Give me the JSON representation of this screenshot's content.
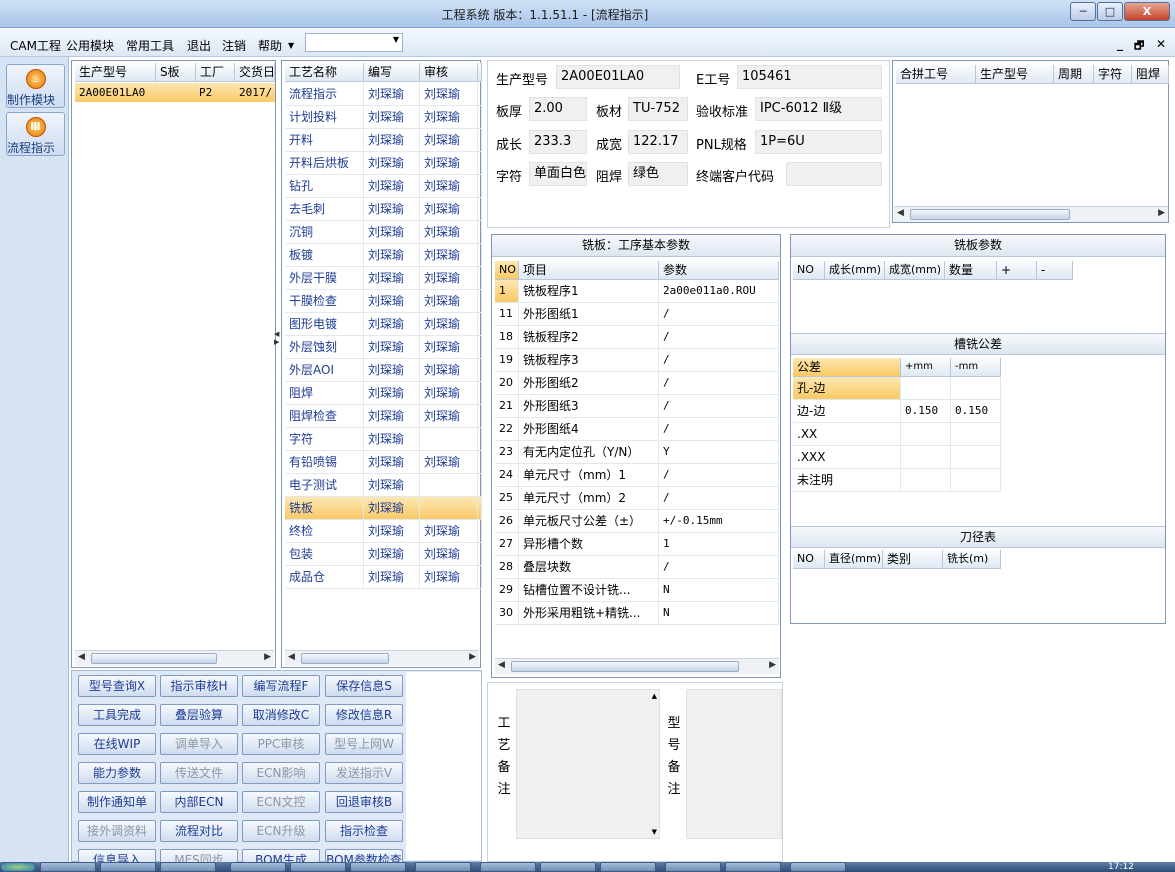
{
  "window": {
    "title": "工程系统   版本：1.1.51.1 - [流程指示]",
    "min_label": "─",
    "max_label": "□",
    "close_label": "X"
  },
  "menu": {
    "items": [
      "CAM工程",
      "公用模块",
      "常用工具",
      "退出",
      "注销",
      "帮助"
    ],
    "combo_value": "",
    "mdi_min": "_",
    "mdi_restore": "🗗",
    "mdi_close": "✕"
  },
  "leftnav": {
    "items": [
      {
        "label": "制作模块"
      },
      {
        "label": "流程指示"
      }
    ]
  },
  "orders": {
    "headers": [
      "生产型号",
      "S板",
      "工厂",
      "交货日"
    ],
    "rows": [
      [
        "2A00E01LA0",
        "",
        "P2",
        "2017/"
      ]
    ]
  },
  "process": {
    "headers": [
      "工艺名称",
      "编写",
      "审核"
    ],
    "rows": [
      [
        "流程指示",
        "刘琛瑜",
        "刘琛瑜"
      ],
      [
        "计划投料",
        "刘琛瑜",
        "刘琛瑜"
      ],
      [
        "开料",
        "刘琛瑜",
        "刘琛瑜"
      ],
      [
        "开料后烘板",
        "刘琛瑜",
        "刘琛瑜"
      ],
      [
        "钻孔",
        "刘琛瑜",
        "刘琛瑜"
      ],
      [
        "去毛刺",
        "刘琛瑜",
        "刘琛瑜"
      ],
      [
        "沉铜",
        "刘琛瑜",
        "刘琛瑜"
      ],
      [
        "板镀",
        "刘琛瑜",
        "刘琛瑜"
      ],
      [
        "外层干膜",
        "刘琛瑜",
        "刘琛瑜"
      ],
      [
        "干膜检查",
        "刘琛瑜",
        "刘琛瑜"
      ],
      [
        "图形电镀",
        "刘琛瑜",
        "刘琛瑜"
      ],
      [
        "外层蚀刻",
        "刘琛瑜",
        "刘琛瑜"
      ],
      [
        "外层AOI",
        "刘琛瑜",
        "刘琛瑜"
      ],
      [
        "阻焊",
        "刘琛瑜",
        "刘琛瑜"
      ],
      [
        "阻焊检查",
        "刘琛瑜",
        "刘琛瑜"
      ],
      [
        "字符",
        "刘琛瑜",
        ""
      ],
      [
        "有铅喷锡",
        "刘琛瑜",
        "刘琛瑜"
      ],
      [
        "电子测试",
        "刘琛瑜",
        ""
      ],
      [
        "铣板",
        "刘琛瑜",
        ""
      ],
      [
        "终检",
        "刘琛瑜",
        "刘琛瑜"
      ],
      [
        "包装",
        "刘琛瑜",
        "刘琛瑜"
      ],
      [
        "成品仓",
        "刘琛瑜",
        "刘琛瑜"
      ]
    ],
    "selected_index": 18
  },
  "buttons": [
    {
      "label": "型号查询X",
      "enabled": true
    },
    {
      "label": "指示审核H",
      "enabled": true
    },
    {
      "label": "编写流程F",
      "enabled": true
    },
    {
      "label": "保存信息S",
      "enabled": true
    },
    {
      "label": "工具完成",
      "enabled": true
    },
    {
      "label": "叠层验算",
      "enabled": true
    },
    {
      "label": "取消修改C",
      "enabled": true
    },
    {
      "label": "修改信息R",
      "enabled": true
    },
    {
      "label": "在线WIP",
      "enabled": true
    },
    {
      "label": "调单导入",
      "enabled": false
    },
    {
      "label": "PPC审核",
      "enabled": false
    },
    {
      "label": "型号上网W",
      "enabled": false
    },
    {
      "label": "能力参数",
      "enabled": true
    },
    {
      "label": "传送文件",
      "enabled": false
    },
    {
      "label": "ECN影响",
      "enabled": false
    },
    {
      "label": "发送指示V",
      "enabled": false
    },
    {
      "label": "制作通知单",
      "enabled": true
    },
    {
      "label": "内部ECN",
      "enabled": true
    },
    {
      "label": "ECN文控",
      "enabled": false
    },
    {
      "label": "回退审核B",
      "enabled": true
    },
    {
      "label": "接外调资料",
      "enabled": false
    },
    {
      "label": "流程对比",
      "enabled": true
    },
    {
      "label": "ECN升级",
      "enabled": false
    },
    {
      "label": "指示检查",
      "enabled": true
    },
    {
      "label": "信息导入",
      "enabled": true
    },
    {
      "label": "MES同步",
      "enabled": false
    },
    {
      "label": "BOM生成",
      "enabled": true
    },
    {
      "label": "BOM参数检查",
      "enabled": true
    }
  ],
  "info": {
    "model_label": "生产型号",
    "model": "2A00E01LA0",
    "e_label": "E工号",
    "e_value": "105461",
    "thick_label": "板厚",
    "thick": "2.00",
    "material_label": "板材",
    "material": "TU-752",
    "std_label": "验收标准",
    "std": "IPC-6012 Ⅱ级",
    "len_label": "成长",
    "len": "233.3",
    "wid_label": "成宽",
    "wid": "122.17",
    "pnl_label": "PNL规格",
    "pnl": "1P=6U",
    "char_label": "字符",
    "char": "单面白色",
    "mask_label": "阻焊",
    "mask": "绿色",
    "cust_label": "终端客户代码",
    "cust": ""
  },
  "panel_table": {
    "headers": [
      "合拼工号",
      "生产型号",
      "周期",
      "字符",
      "阻焊"
    ]
  },
  "params": {
    "title": "铣板：工序基本参数",
    "headers": [
      "NO",
      "项目",
      "参数"
    ],
    "rows": [
      [
        "1",
        "铣板程序1",
        "2a00e011a0.ROU"
      ],
      [
        "11",
        "外形图纸1",
        "/"
      ],
      [
        "18",
        "铣板程序2",
        "/"
      ],
      [
        "19",
        "铣板程序3",
        "/"
      ],
      [
        "20",
        "外形图纸2",
        "/"
      ],
      [
        "21",
        "外形图纸3",
        "/"
      ],
      [
        "22",
        "外形图纸4",
        "/"
      ],
      [
        "23",
        "有无内定位孔（Y/N）",
        "Y"
      ],
      [
        "24",
        "单元尺寸（mm）1",
        "/"
      ],
      [
        "25",
        "单元尺寸（mm）2",
        "/"
      ],
      [
        "26",
        "单元板尺寸公差（±）",
        "+/-0.15mm"
      ],
      [
        "27",
        "异形槽个数",
        "1"
      ],
      [
        "28",
        "叠层块数",
        "/"
      ],
      [
        "29",
        "钻槽位置不设计铣...",
        "N"
      ],
      [
        "30",
        "外形采用粗铣+精铣...",
        "N"
      ]
    ]
  },
  "mill": {
    "title": "铣板参数",
    "headers": [
      "NO",
      "成长(mm)",
      "成宽(mm)",
      "数量",
      "+",
      "-"
    ]
  },
  "slot": {
    "title": "槽铣公差",
    "headers": [
      "公差",
      "+mm",
      "-mm"
    ],
    "rows": [
      [
        "孔-边",
        "",
        ""
      ],
      [
        "边-边",
        "0.150",
        "0.150"
      ],
      [
        ".XX",
        "",
        ""
      ],
      [
        ".XXX",
        "",
        ""
      ],
      [
        "未注明",
        "",
        ""
      ]
    ]
  },
  "tool": {
    "title": "刀径表",
    "headers": [
      "NO",
      "直径(mm)",
      "类别",
      "铣长(m)"
    ]
  },
  "notes": {
    "process_label": "工艺备注",
    "model_label": "型号备注"
  },
  "clock": "17:12"
}
